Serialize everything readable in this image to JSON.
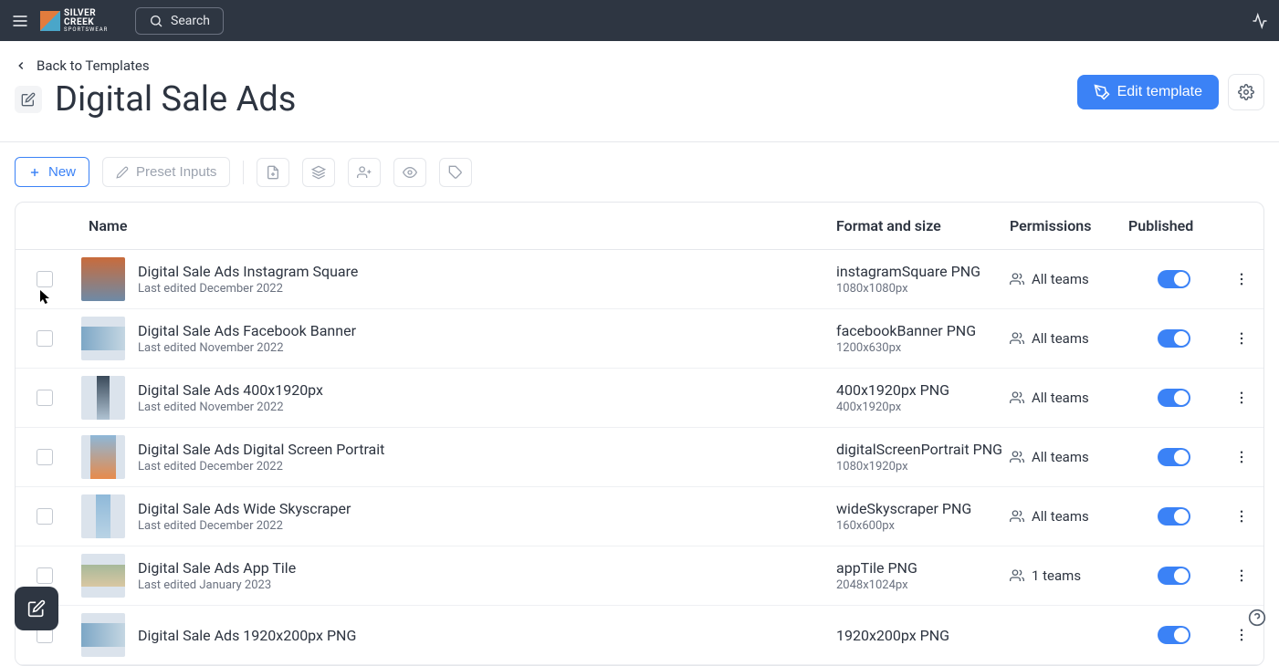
{
  "topbar": {
    "brand_line1": "SILVER",
    "brand_line2": "CREEK",
    "brand_sub": "SPORTSWEAR",
    "search_label": "Search"
  },
  "header": {
    "back_label": "Back to Templates",
    "title": "Digital Sale Ads",
    "edit_button": "Edit template"
  },
  "toolbar": {
    "new_label": "New",
    "preset_label": "Preset Inputs"
  },
  "table": {
    "columns": {
      "name": "Name",
      "format": "Format and size",
      "permissions": "Permissions",
      "published": "Published"
    },
    "rows": [
      {
        "name": "Digital Sale Ads Instagram Square",
        "edited": "Last edited December 2022",
        "format": "instagramSquare PNG",
        "size": "1080x1080px",
        "permissions": "All teams",
        "published": true,
        "thumb": "square"
      },
      {
        "name": "Digital Sale Ads Facebook Banner",
        "edited": "Last edited November 2022",
        "format": "facebookBanner PNG",
        "size": "1200x630px",
        "permissions": "All teams",
        "published": true,
        "thumb": "banner"
      },
      {
        "name": "Digital Sale Ads 400x1920px",
        "edited": "Last edited November 2022",
        "format": "400x1920px PNG",
        "size": "400x1920px",
        "permissions": "All teams",
        "published": true,
        "thumb": "tall"
      },
      {
        "name": "Digital Sale Ads Digital Screen Portrait",
        "edited": "Last edited December 2022",
        "format": "digitalScreenPortrait PNG",
        "size": "1080x1920px",
        "permissions": "All teams",
        "published": true,
        "thumb": "portrait"
      },
      {
        "name": "Digital Sale Ads Wide Skyscraper",
        "edited": "Last edited December 2022",
        "format": "wideSkyscraper PNG",
        "size": "160x600px",
        "permissions": "All teams",
        "published": true,
        "thumb": "sky"
      },
      {
        "name": "Digital Sale Ads App Tile",
        "edited": "Last edited January 2023",
        "format": "appTile PNG",
        "size": "2048x1024px",
        "permissions": "1 teams",
        "published": true,
        "thumb": "tile"
      },
      {
        "name": "Digital Sale Ads 1920x200px PNG",
        "edited": "",
        "format": "1920x200px PNG",
        "size": "",
        "permissions": "",
        "published": true,
        "thumb": "banner"
      }
    ]
  }
}
